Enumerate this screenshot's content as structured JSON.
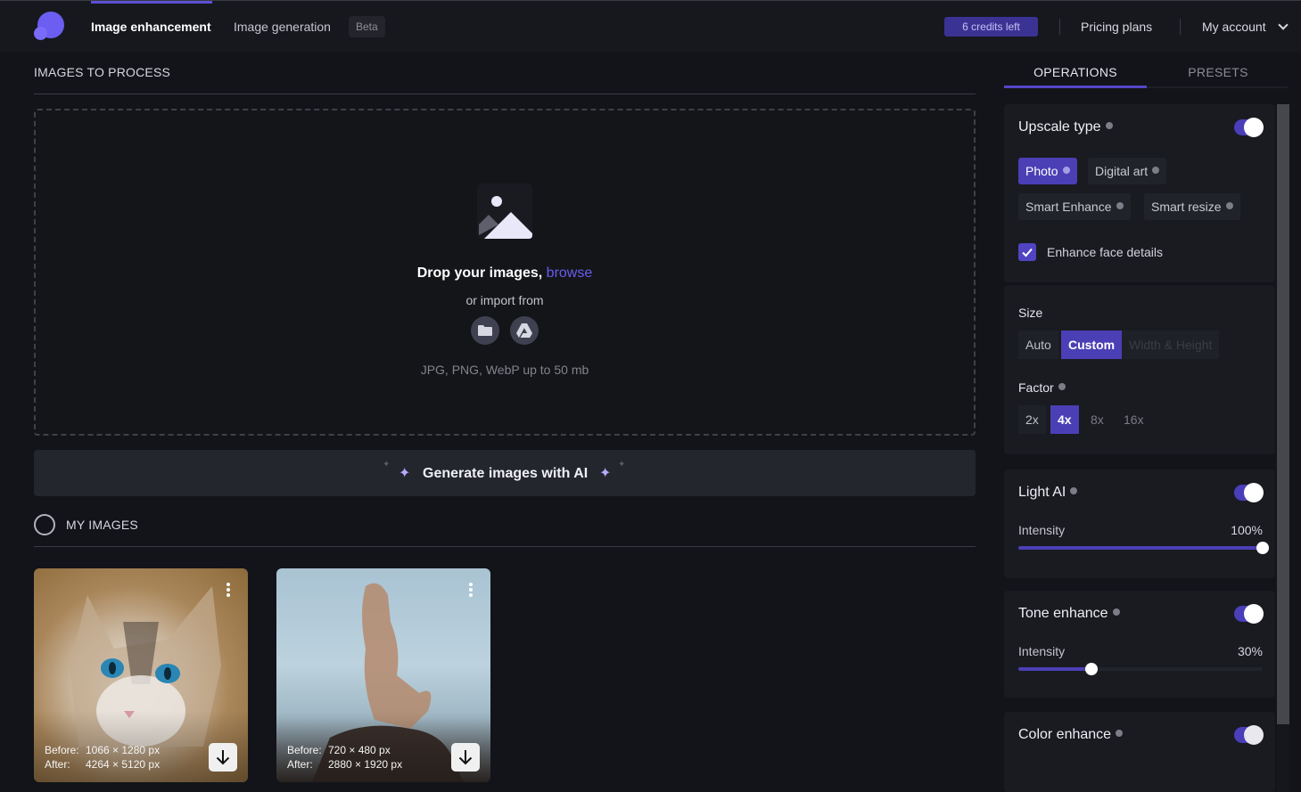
{
  "header": {
    "nav": [
      {
        "label": "Image enhancement",
        "active": true
      },
      {
        "label": "Image generation",
        "active": false
      }
    ],
    "beta_badge": "Beta",
    "credits": "6 credits left",
    "pricing": "Pricing plans",
    "account": "My account",
    "accent_color": "#5b4fd6"
  },
  "upload": {
    "section_title": "IMAGES TO PROCESS",
    "drop_text": "Drop your images,",
    "browse_link": "browse",
    "import_text": "or import from",
    "import_sources": [
      "folder-icon",
      "google-drive-icon"
    ],
    "formats": "JPG, PNG, WebP up to 50 mb"
  },
  "generate": {
    "label": "Generate images with AI"
  },
  "my_images": {
    "section_title": "MY IMAGES",
    "items": [
      {
        "subject": "cat",
        "before_label": "Before:",
        "before": "1066 × 1280 px",
        "after_label": "After:",
        "after": "4264 × 5120 px"
      },
      {
        "subject": "woman on rock",
        "before_label": "Before:",
        "before": "720 × 480 px",
        "after_label": "After:",
        "after": "2880 × 1920 px"
      }
    ]
  },
  "panel": {
    "tabs": [
      {
        "label": "OPERATIONS",
        "active": true
      },
      {
        "label": "PRESETS",
        "active": false
      }
    ],
    "upscale": {
      "title": "Upscale type",
      "enabled": true,
      "types": [
        {
          "label": "Photo",
          "active": true
        },
        {
          "label": "Digital art",
          "active": false
        },
        {
          "label": "Smart Enhance",
          "active": false
        },
        {
          "label": "Smart resize",
          "active": false
        }
      ],
      "face_details_label": "Enhance face details",
      "face_details_checked": true
    },
    "size": {
      "label": "Size",
      "options": [
        {
          "label": "Auto",
          "state": "normal"
        },
        {
          "label": "Custom",
          "state": "active"
        },
        {
          "label": "Width & Height",
          "state": "disabled"
        }
      ]
    },
    "factor": {
      "label": "Factor",
      "options": [
        {
          "label": "2x",
          "active": false
        },
        {
          "label": "4x",
          "active": true
        },
        {
          "label": "8x",
          "active": false
        },
        {
          "label": "16x",
          "active": false
        }
      ]
    },
    "light_ai": {
      "title": "Light AI",
      "enabled": true,
      "intensity_label": "Intensity",
      "intensity": "100%",
      "intensity_value": 100
    },
    "tone_enhance": {
      "title": "Tone enhance",
      "enabled": true,
      "intensity_label": "Intensity",
      "intensity": "30%",
      "intensity_value": 30
    },
    "color_enhance": {
      "title": "Color enhance",
      "enabled": true
    }
  }
}
